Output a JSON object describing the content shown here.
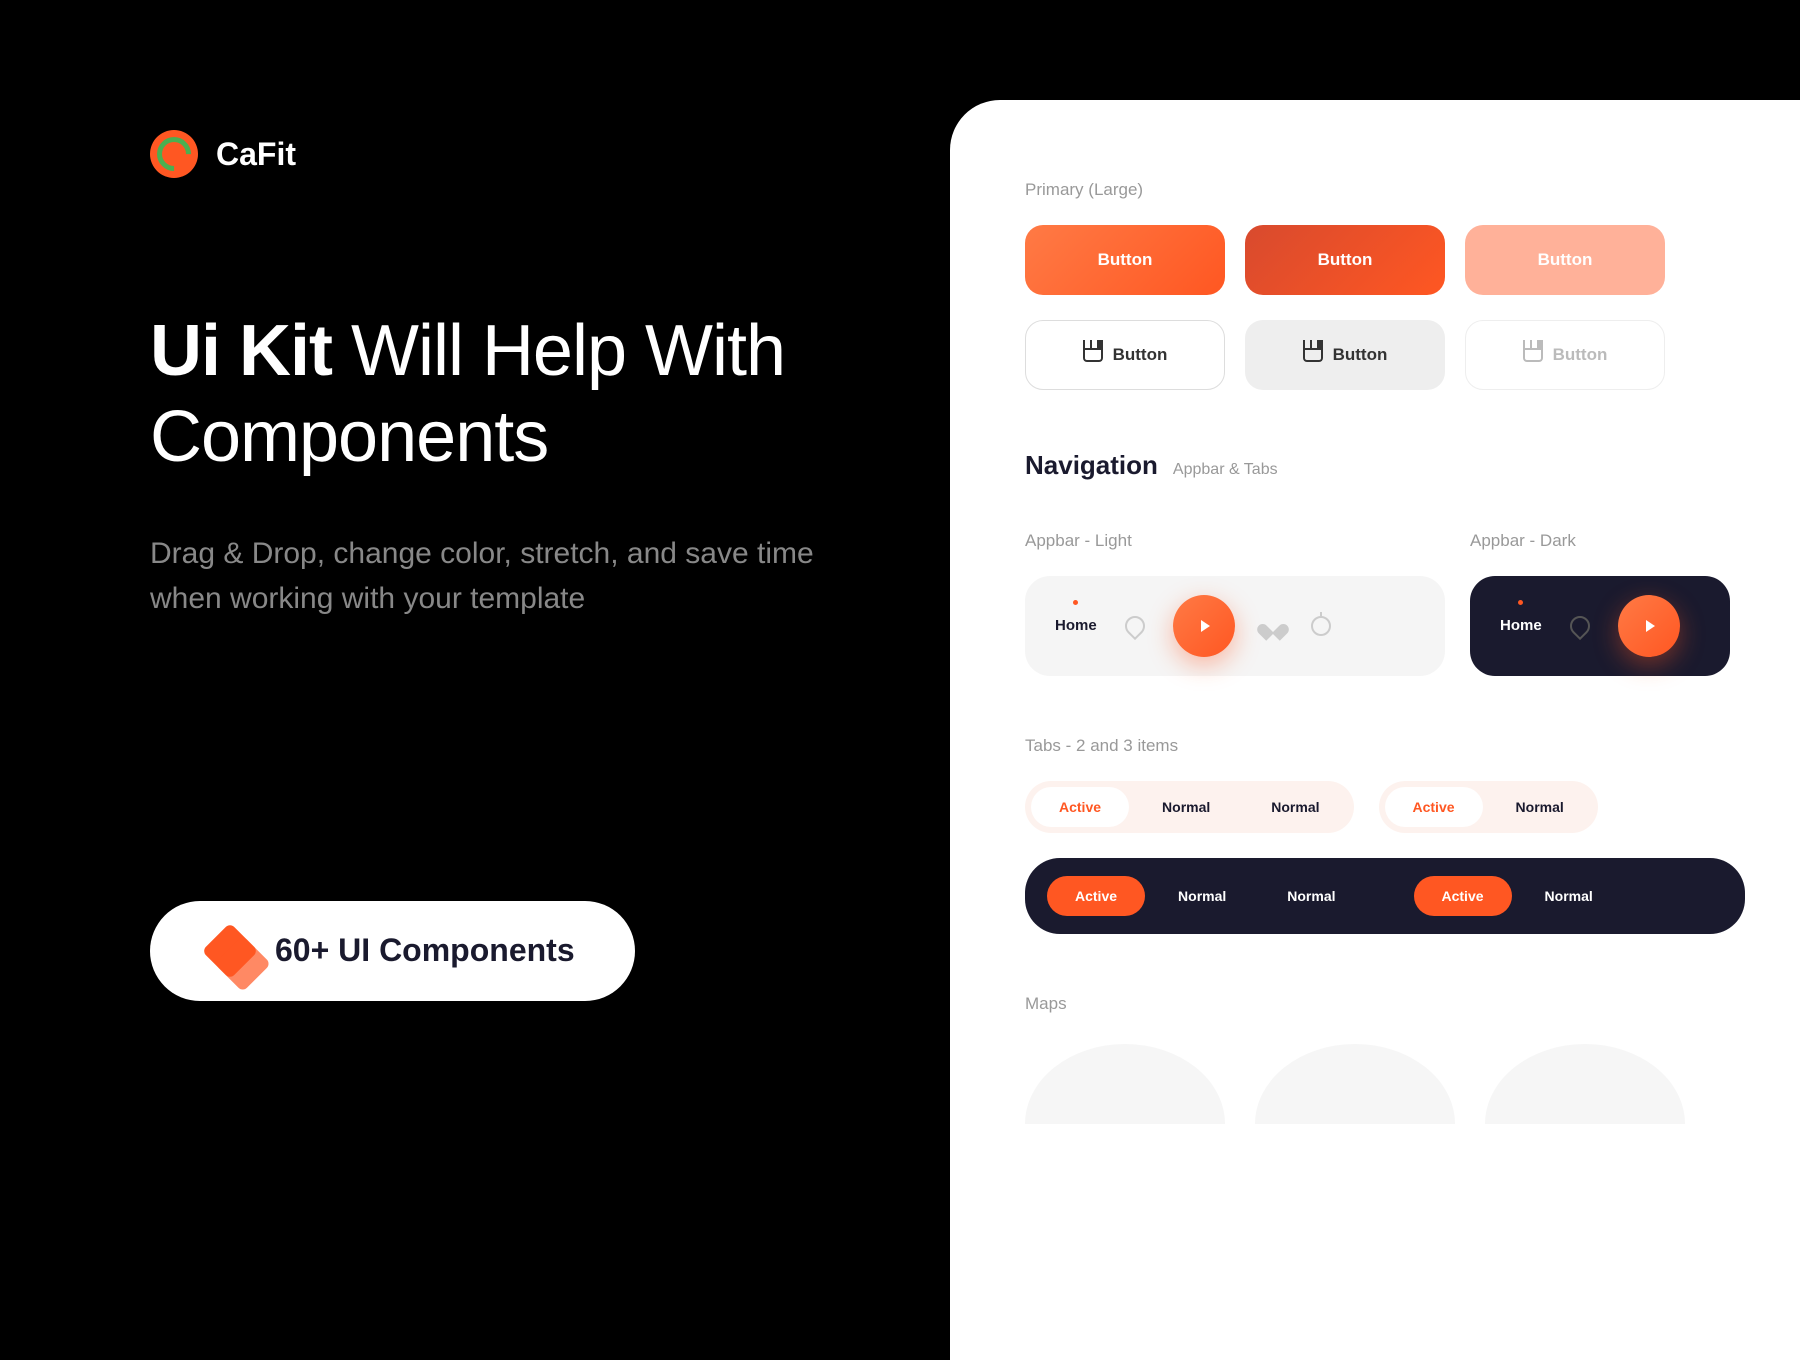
{
  "brand": {
    "name": "CaFit"
  },
  "headline": {
    "bold": "Ui Kit",
    "rest": " Will Help With Components"
  },
  "subtitle": "Drag & Drop, change color, stretch, and save time when working with your template",
  "badge": {
    "text": "60+ UI Components"
  },
  "panel": {
    "primary_label": "Primary (Large)",
    "button_label": "Button",
    "nav_title": "Navigation",
    "nav_sub": "Appbar & Tabs",
    "appbar_light": "Appbar - Light",
    "appbar_dark": "Appbar - Dark",
    "home": "Home",
    "tabs_label": "Tabs - 2 and 3 items",
    "active": "Active",
    "normal": "Normal",
    "maps": "Maps"
  }
}
